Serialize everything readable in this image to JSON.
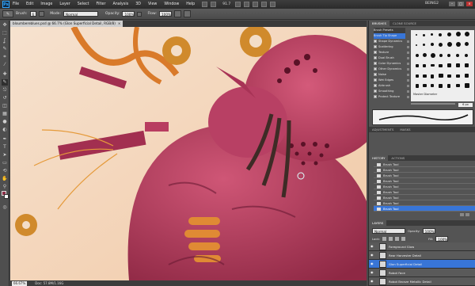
{
  "menubar": {
    "logo": "Ps",
    "items": [
      "File",
      "Edit",
      "Image",
      "Layer",
      "Select",
      "Filter",
      "Analysis",
      "3D",
      "View",
      "Window",
      "Help"
    ],
    "zoom": "91.7",
    "workspace": "BEING2",
    "window_buttons": [
      "–",
      "□",
      "×"
    ]
  },
  "options": {
    "brush_label": "Brush:",
    "brush_size": "6",
    "mode_label": "Mode:",
    "mode_value": "Normal",
    "opacity_label": "Opacity:",
    "opacity_value": "100%",
    "flow_label": "Flow:",
    "flow_value": "100%"
  },
  "document": {
    "tab_title": "bloumbereblues.psd @ 66.7% (Glon Superficial Detail, RGB/8)",
    "tab_close": "×",
    "zoom": "66.67%",
    "doc_info": "Doc: 57.8M/1.16G"
  },
  "toolbox": {
    "tools": [
      "move",
      "marquee",
      "lasso",
      "quick-select",
      "crop",
      "eyedropper",
      "healing",
      "brush",
      "clone",
      "history-brush",
      "eraser",
      "gradient",
      "blur",
      "dodge",
      "pen",
      "type",
      "path-select",
      "shape",
      "3d-rotate",
      "hand",
      "zoom"
    ],
    "glyphs": [
      "✥",
      "⬚",
      "ʆ",
      "✎",
      "⌗",
      "⁄",
      "✚",
      "✎",
      "⎋",
      "↺",
      "◫",
      "▦",
      "●",
      "◐",
      "✒",
      "T",
      "➤",
      "▭",
      "⟲",
      "✋",
      "⚲"
    ],
    "foreground_color": "#8f2f48",
    "background_color": "#ffffff"
  },
  "brushes_panel": {
    "tabs": [
      "BRUSHES",
      "CLONE SOURCE"
    ],
    "list": [
      {
        "label": "Brush Presets",
        "checked": false
      },
      {
        "label": "Brush Tip Shape",
        "checked": false
      },
      {
        "label": "Shape Dynamics",
        "checked": true
      },
      {
        "label": "Scattering",
        "checked": false
      },
      {
        "label": "Texture",
        "checked": false
      },
      {
        "label": "Dual Brush",
        "checked": false
      },
      {
        "label": "Color Dynamics",
        "checked": false
      },
      {
        "label": "Other Dynamics",
        "checked": true
      },
      {
        "label": "Noise",
        "checked": false
      },
      {
        "label": "Wet Edges",
        "checked": false
      },
      {
        "label": "Airbrush",
        "checked": false
      },
      {
        "label": "Smoothing",
        "checked": true
      },
      {
        "label": "Protect Texture",
        "checked": false
      }
    ],
    "master_diameter_label": "Master Diameter",
    "master_diameter_value": "6 px"
  },
  "adjustments_tabs": [
    "ADJUSTMENTS",
    "MASKS"
  ],
  "history_panel": {
    "tabs": [
      "HISTORY",
      "ACTIONS"
    ],
    "items": [
      "Brush Tool",
      "Brush Tool",
      "Brush Tool",
      "Brush Tool",
      "Brush Tool",
      "Brush Tool",
      "Brush Tool",
      "Brush Tool",
      "Brush Tool"
    ],
    "active_index": 8
  },
  "layers_panel": {
    "tabs": [
      "LAYERS"
    ],
    "blend_mode": "Normal",
    "opacity_label": "Opacity:",
    "opacity_value": "100%",
    "lock_label": "Lock:",
    "fill_label": "Fill:",
    "fill_value": "100%",
    "layers": [
      {
        "name": "Foreground Glow",
        "active": false
      },
      {
        "name": "Rear Harvester Detail",
        "active": false
      },
      {
        "name": "Glon Superficial Detail",
        "active": true
      },
      {
        "name": "Robot Face",
        "active": false
      },
      {
        "name": "Robot Bronze Metallic Detail",
        "active": false
      }
    ]
  }
}
